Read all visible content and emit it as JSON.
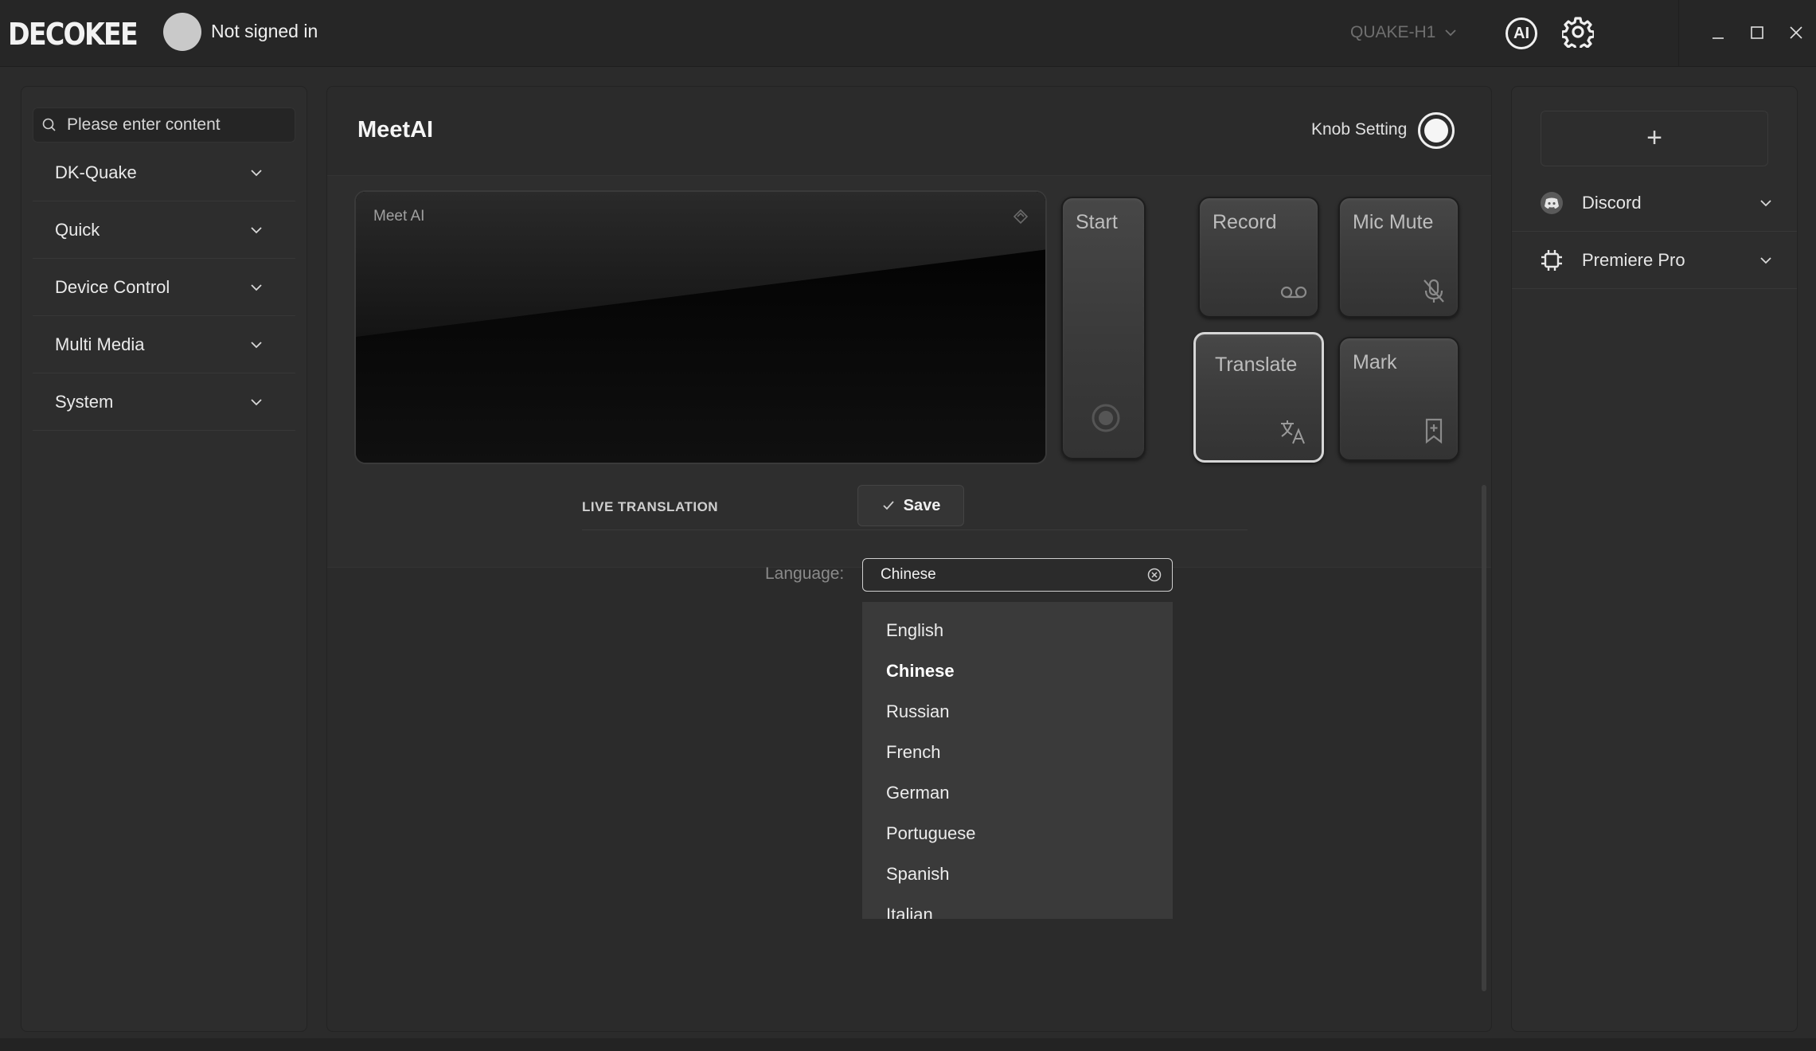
{
  "app": {
    "logo_text": "DECOKEE"
  },
  "header": {
    "user_status": "Not signed in",
    "device": "QUAKE-H1",
    "ai_label": "AI"
  },
  "sidebar": {
    "search_placeholder": "Please enter content",
    "items": [
      {
        "label": "DK-Quake"
      },
      {
        "label": "Quick"
      },
      {
        "label": "Device Control"
      },
      {
        "label": "Multi Media"
      },
      {
        "label": "System"
      }
    ]
  },
  "main": {
    "title": "MeetAI",
    "knob_label": "Knob Setting",
    "screen_title": "Meet AI",
    "keys": {
      "start": "Start",
      "record": "Record",
      "mic_mute": "Mic Mute",
      "translate": "Translate",
      "mark": "Mark"
    },
    "section_label": "LIVE TRANSLATION",
    "save_label": "Save",
    "language_label": "Language:",
    "language_value": "Chinese",
    "language_options": [
      "English",
      "Chinese",
      "Russian",
      "French",
      "German",
      "Portuguese",
      "Spanish",
      "Italian"
    ]
  },
  "right_panel": {
    "add_label": "+",
    "apps": [
      {
        "label": "Discord",
        "icon": "discord-icon"
      },
      {
        "label": "Premiere Pro",
        "icon": "chip-icon"
      }
    ]
  }
}
